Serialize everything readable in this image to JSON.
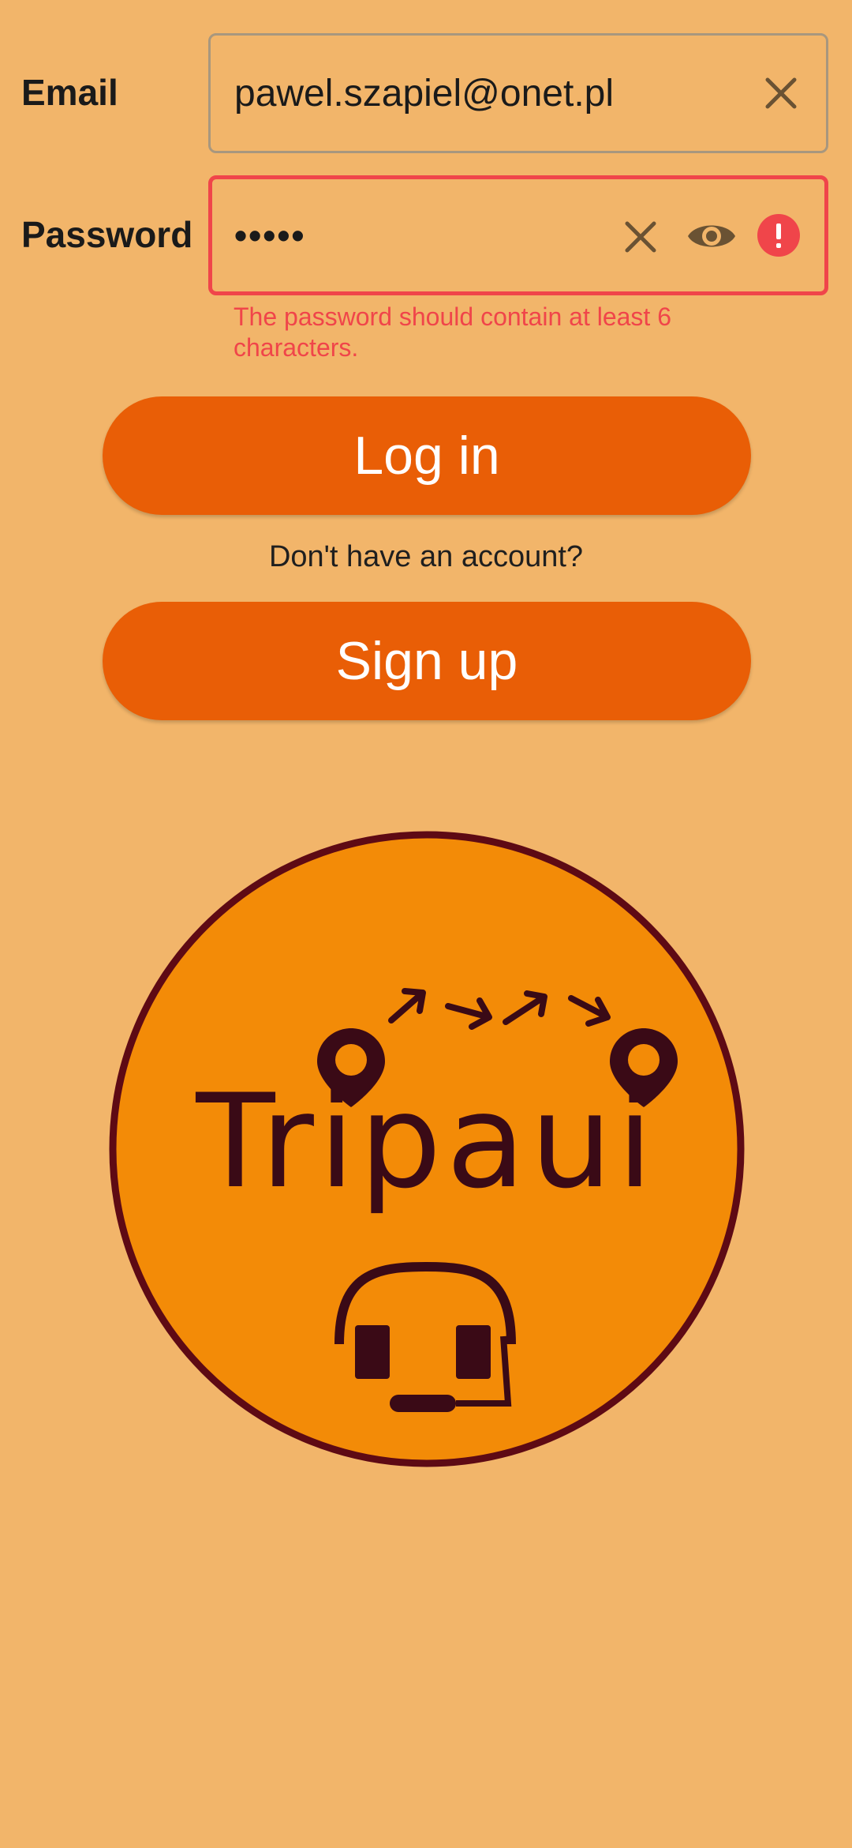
{
  "form": {
    "email_label": "Email",
    "email_value": "pawel.szapiel@onet.pl",
    "password_label": "Password",
    "password_value": "•••••",
    "password_error": "The password should contain at least 6 characters."
  },
  "actions": {
    "login_label": "Log in",
    "signup_prompt": "Don't have an account?",
    "signup_label": "Sign up"
  },
  "logo": {
    "wordmark": "Tripaui",
    "description_icons": [
      "map-pin-icon",
      "arrow-icon",
      "headset-icon"
    ]
  },
  "colors": {
    "background": "#f2b56a",
    "button": "#e95e06",
    "error": "#f0454a",
    "logo_fill": "#f38b07",
    "logo_ink": "#5e0a14"
  },
  "icons": {
    "email_clear": "close-icon",
    "password_clear": "close-icon",
    "password_visibility": "eye-icon",
    "password_error": "alert-circle-icon"
  }
}
